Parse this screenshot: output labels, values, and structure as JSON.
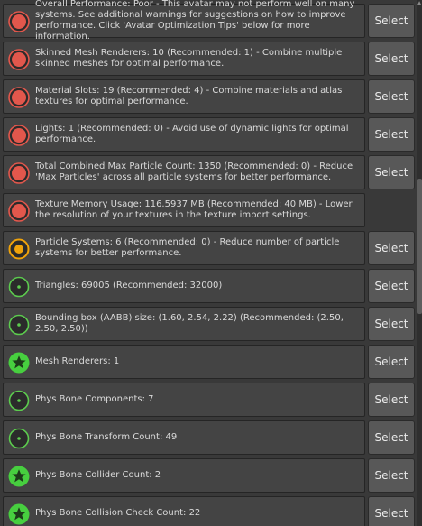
{
  "colors": {
    "poor": "#e2574c",
    "medium": "#f0a30a",
    "good": "#5ccc4e",
    "excellent": "#47cf3f"
  },
  "items": [
    {
      "status": "poor",
      "icon": "poor-rating-icon",
      "text": "Overall Performance: Poor - This avatar may not perform well on many systems. See additional warnings for suggestions on how to improve performance. Click 'Avatar Optimization Tips' below for more information.",
      "button": "Select"
    },
    {
      "status": "poor",
      "icon": "poor-rating-icon",
      "text": "Skinned Mesh Renderers: 10 (Recommended: 1) - Combine multiple skinned meshes for optimal performance.",
      "button": "Select"
    },
    {
      "status": "poor",
      "icon": "poor-rating-icon",
      "text": "Material Slots: 19 (Recommended: 4) - Combine materials and atlas textures for optimal performance.",
      "button": "Select"
    },
    {
      "status": "poor",
      "icon": "poor-rating-icon",
      "text": "Lights: 1 (Recommended: 0) - Avoid use of dynamic lights for optimal performance.",
      "button": "Select"
    },
    {
      "status": "poor",
      "icon": "poor-rating-icon",
      "text": "Total Combined Max Particle Count: 1350 (Recommended: 0) - Reduce 'Max Particles' across all particle systems for better performance.",
      "button": "Select"
    },
    {
      "status": "poor",
      "icon": "poor-rating-icon",
      "text": "Texture Memory Usage: 116.5937 MB (Recommended: 40 MB) - Lower the resolution of your textures in the texture import settings.",
      "button": null
    },
    {
      "status": "medium",
      "icon": "medium-rating-icon",
      "text": "Particle Systems: 6 (Recommended: 0) - Reduce number of particle systems for better performance.",
      "button": "Select"
    },
    {
      "status": "good",
      "icon": "good-rating-icon",
      "text": "Triangles: 69005 (Recommended: 32000)",
      "button": "Select"
    },
    {
      "status": "good",
      "icon": "good-rating-icon",
      "text": "Bounding box (AABB) size: (1.60, 2.54, 2.22) (Recommended: (2.50, 2.50, 2.50))",
      "button": "Select"
    },
    {
      "status": "excellent",
      "icon": "excellent-rating-star-icon",
      "text": "Mesh Renderers: 1",
      "button": "Select"
    },
    {
      "status": "good",
      "icon": "good-rating-icon",
      "text": "Phys Bone Components: 7",
      "button": "Select"
    },
    {
      "status": "good",
      "icon": "good-rating-icon",
      "text": "Phys Bone Transform Count: 49",
      "button": "Select"
    },
    {
      "status": "excellent",
      "icon": "excellent-rating-star-icon",
      "text": "Phys Bone Collider Count: 2",
      "button": "Select"
    },
    {
      "status": "excellent",
      "icon": "excellent-rating-star-icon",
      "text": "Phys Bone Collision Check Count: 22",
      "button": "Select"
    }
  ]
}
